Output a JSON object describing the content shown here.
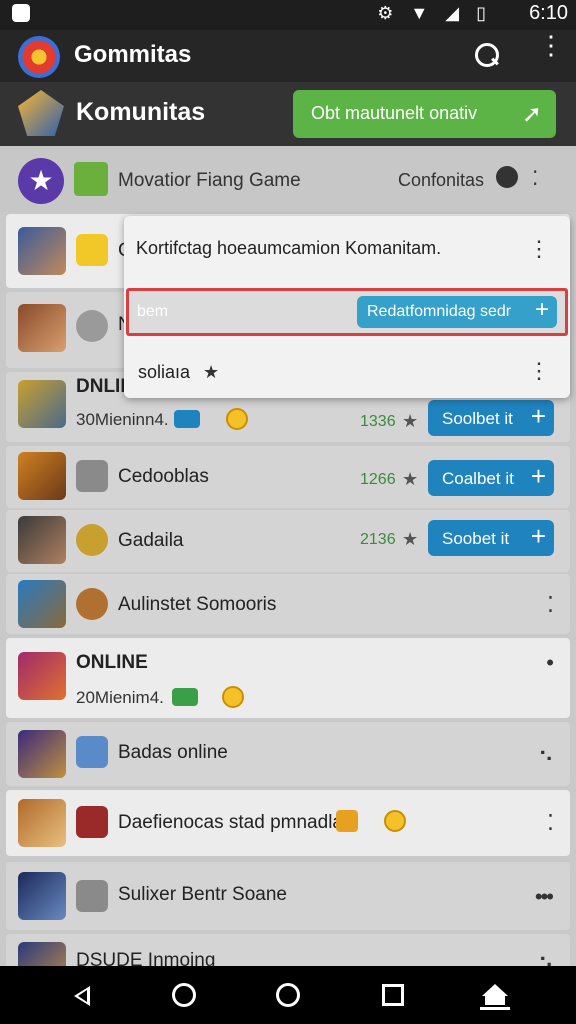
{
  "status_bar": {
    "time": "6:10",
    "icons": "⚙ ▼ ◢ ▯"
  },
  "app_bar": {
    "title": "Gommitas",
    "more_icon": "⋮"
  },
  "hero": {
    "title": "Komunitas",
    "button_label": "Obt mautunelt onativ",
    "button_icon": "➚"
  },
  "featured": {
    "title": "Movatior Fiang Game",
    "right_label": "Confonitas",
    "star_icon": "★",
    "dots": "⁚"
  },
  "popup": {
    "header": "Kortifctag hoeaumcamion Komanitam.",
    "header_more": "⋮",
    "field_placeholder": "bem",
    "field_button": "Redatfomnidag sedr",
    "plus": "+",
    "list_item": "soliaıa",
    "list_star": "★",
    "list_more": "⋮"
  },
  "rows": [
    {
      "title": "G",
      "count": ""
    },
    {
      "title": "N",
      "count": ""
    },
    {
      "title": "DNLID",
      "subtitle": "30Mieninn4.",
      "rating": "1336",
      "button": "Soolbet it",
      "star": "★",
      "plus": "+"
    },
    {
      "title": "Cedooblas",
      "rating": "1266",
      "button": "Coalbet it",
      "star": "★",
      "plus": "+"
    },
    {
      "title": "Gadaila",
      "rating": "2136",
      "button": "Soobet it",
      "star": "★",
      "plus": "+"
    },
    {
      "title": "Aulinstet Somooris",
      "more": "⁚"
    },
    {
      "title": "ONLINE",
      "subtitle": "20Mienim4.",
      "more": "•"
    },
    {
      "title": "Badas online",
      "more": "⠢"
    },
    {
      "title": "Daefienocas stad pmnadla",
      "more": "⁚"
    },
    {
      "title": "Sulixer Bentr Soane",
      "more": "•••"
    },
    {
      "title": "DSUDE Inmoing",
      "more": "⠢"
    }
  ],
  "nav": {
    "back": "back",
    "home": "home",
    "recents": "recents"
  }
}
